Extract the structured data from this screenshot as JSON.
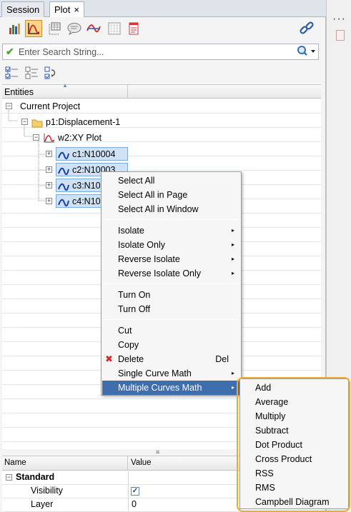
{
  "tabs": [
    {
      "label": "Session"
    },
    {
      "label": "Plot",
      "close": "×"
    }
  ],
  "toolbar": {
    "icons": [
      "bar-chart-icon",
      "xy-plot-icon",
      "table-icon",
      "annotation-bubble-icon",
      "curve-icon",
      "grid-icon",
      "page-icon"
    ],
    "link_icon": "chain-link-icon"
  },
  "search": {
    "placeholder": "Enter Search String...",
    "value": ""
  },
  "tree": {
    "column_header": "Entities",
    "nodes": {
      "project": "Current Project",
      "page": "p1:Displacement-1",
      "plot": "w2:XY Plot",
      "curves": [
        "c1:N10004",
        "c2:N10003",
        "c3:N10",
        "c4:N10"
      ]
    }
  },
  "context_menu": {
    "groups": [
      [
        "Select All",
        "Select All in Page",
        "Select All in Window"
      ],
      [
        "Isolate",
        "Isolate Only",
        "Reverse Isolate",
        "Reverse Isolate Only"
      ],
      [
        "Turn On",
        "Turn Off"
      ],
      [
        "Cut",
        "Copy",
        "Delete",
        "Single Curve Math",
        "Multiple Curves Math"
      ]
    ],
    "submenu_arrow": "▸",
    "delete_shortcut": "Del",
    "delete_icon": "✖"
  },
  "submenu": {
    "items": [
      "Add",
      "Average",
      "Multiply",
      "Subtract",
      "Dot Product",
      "Cross Product",
      "RSS",
      "RMS",
      "Campbell Diagram"
    ]
  },
  "properties": {
    "headers": {
      "name": "Name",
      "value": "Value"
    },
    "section": "Standard",
    "section_toggle": "−",
    "rows": [
      {
        "name": "Visibility",
        "value": "✓"
      },
      {
        "name": "Layer",
        "value": "0"
      }
    ],
    "grip": "≡"
  },
  "right_strip": {
    "dots": "⋮"
  },
  "colors": {
    "highlight": "#3f6eaf",
    "selection_outline": "#f0a92a",
    "curve_blue": "#1b3fa8"
  }
}
